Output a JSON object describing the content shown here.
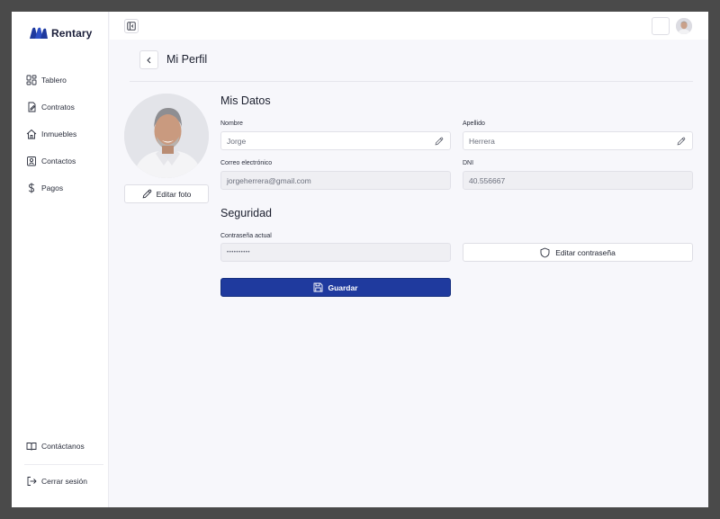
{
  "brand": {
    "name": "Rentary",
    "accent": "#1f3a9e"
  },
  "sidebar": {
    "items": [
      {
        "label": "Tablero",
        "icon": "dashboard-icon"
      },
      {
        "label": "Contratos",
        "icon": "contract-icon"
      },
      {
        "label": "Inmuebles",
        "icon": "house-icon"
      },
      {
        "label": "Contactos",
        "icon": "contacts-icon"
      },
      {
        "label": "Pagos",
        "icon": "dollar-icon"
      }
    ],
    "footer": [
      {
        "label": "Contáctanos",
        "icon": "book-icon"
      },
      {
        "label": "Cerrar sesión",
        "icon": "logout-icon"
      }
    ]
  },
  "page": {
    "title": "Mi Perfil"
  },
  "profile": {
    "edit_photo_label": "Editar foto"
  },
  "mis_datos": {
    "title": "Mis Datos",
    "nombre": {
      "label": "Nombre",
      "value": "Jorge"
    },
    "apellido": {
      "label": "Apellido",
      "value": "Herrera"
    },
    "correo": {
      "label": "Correo electrónico",
      "value": "jorgeherrera@gmail.com"
    },
    "dni": {
      "label": "DNI",
      "value": "40.556667"
    }
  },
  "seguridad": {
    "title": "Seguridad",
    "password": {
      "label": "Contraseña actual",
      "value": "••••••••••"
    },
    "edit_password_label": "Editar contraseña"
  },
  "actions": {
    "save_label": "Guardar"
  }
}
